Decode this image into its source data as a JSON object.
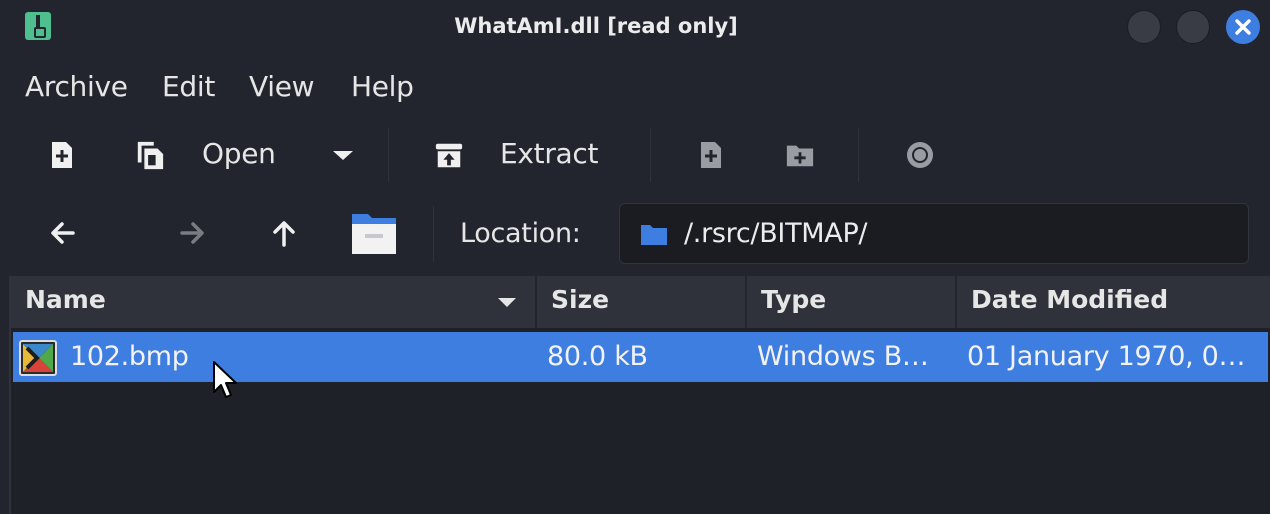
{
  "window": {
    "title": "WhatAmI.dll [read only]"
  },
  "menu": [
    "Archive",
    "Edit",
    "View",
    "Help"
  ],
  "toolbar": {
    "open_label": "Open",
    "extract_label": "Extract"
  },
  "location": {
    "label": "Location:",
    "path": "/.rsrc/BITMAP/"
  },
  "columns": [
    "Name",
    "Size",
    "Type",
    "Date Modified"
  ],
  "files": [
    {
      "name": "102.bmp",
      "size": "80.0 kB",
      "type": "Windows B…",
      "modified": "01 January 1970, 0…",
      "selected": true
    }
  ],
  "colors": {
    "accent": "#3d7ee0",
    "background": "#23252e",
    "app_icon": "#4fbf8f"
  },
  "icons": {
    "app": "archive-manager-icon",
    "new": "new-archive-icon",
    "open": "open-archive-icon",
    "extract": "extract-icon",
    "add_files": "add-files-icon",
    "add_folder": "add-folder-icon",
    "stop": "stop-icon",
    "back": "back-arrow-icon",
    "forward": "forward-arrow-icon",
    "up": "up-arrow-icon",
    "home": "home-folder-icon",
    "folder": "folder-icon",
    "file": "image-file-icon"
  }
}
